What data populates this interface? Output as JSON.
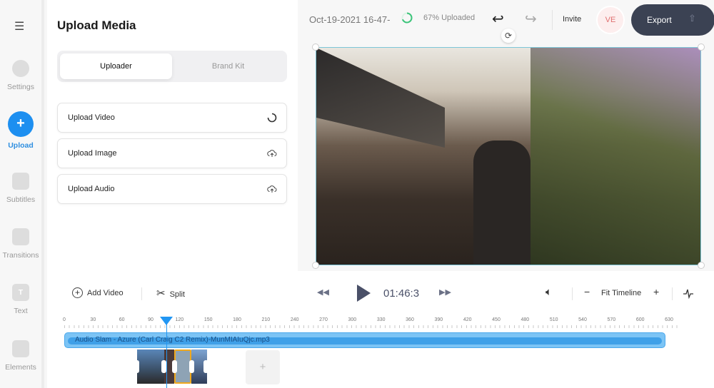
{
  "sidebar": {
    "items": [
      {
        "label": "Settings"
      },
      {
        "label": "Upload"
      },
      {
        "label": "Subtitles"
      },
      {
        "label": "Transitions"
      },
      {
        "label": "Text"
      },
      {
        "label": "Elements"
      }
    ]
  },
  "panel": {
    "title": "Upload Media",
    "tabs": [
      "Uploader",
      "Brand Kit"
    ],
    "buttons": [
      "Upload Video",
      "Upload Image",
      "Upload Audio"
    ]
  },
  "topbar": {
    "project_name": "Oct-19-2021 16-47-",
    "upload_status": "67% Uploaded",
    "upload_progress": 67,
    "invite": "Invite",
    "avatar": "VE",
    "export": "Export"
  },
  "toolbar": {
    "add_video": "Add Video",
    "split": "Split",
    "time": "01:46:3",
    "fit_timeline": "Fit Timeline"
  },
  "timeline": {
    "ticks": [
      0,
      30,
      60,
      90,
      120,
      150,
      180,
      210,
      240,
      270,
      300,
      330,
      360,
      390,
      420,
      450,
      480,
      510,
      540,
      570,
      600,
      630
    ],
    "playhead": 106,
    "audio_track": "Audio Slam - Azure (Carl Craig C2 Remix)-MunMIAIuQjc.mp3",
    "add_clip": "+"
  },
  "colors": {
    "accent": "#2196f3",
    "export_bg": "#3b4253"
  }
}
